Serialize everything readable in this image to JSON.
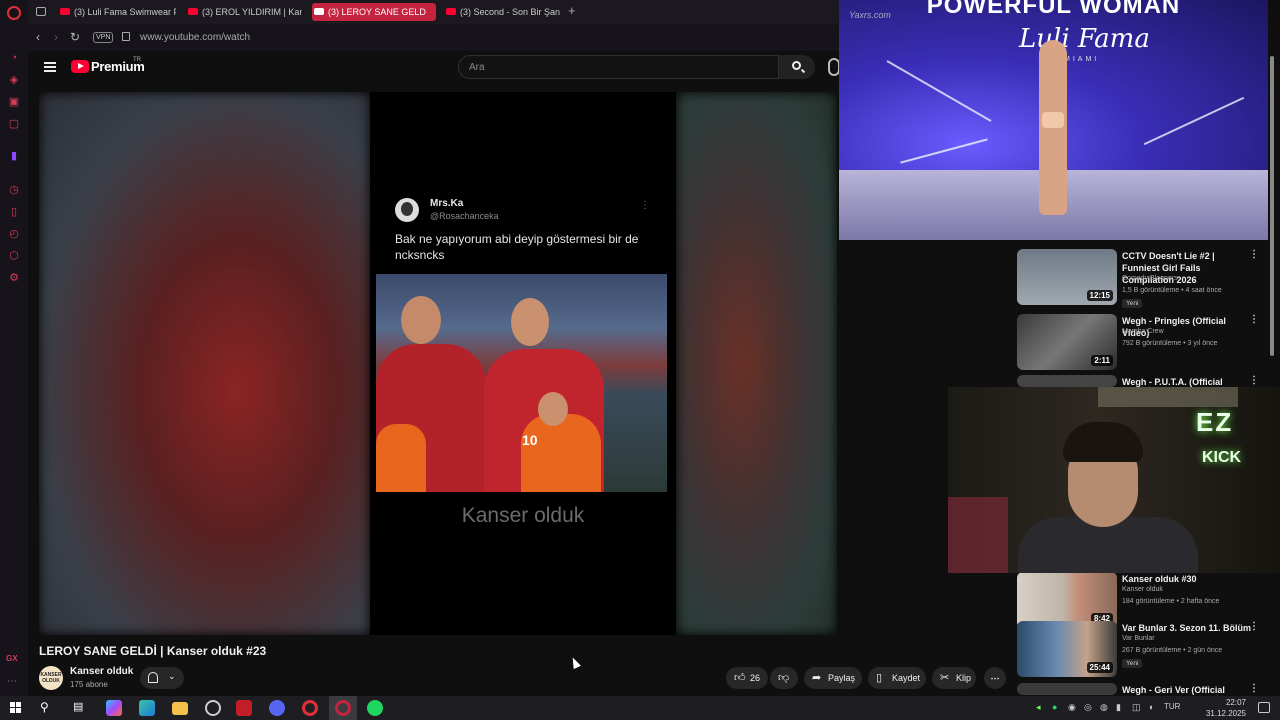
{
  "browser": {
    "tabs": [
      {
        "label": "(3) Luli Fama Swimwear Fa"
      },
      {
        "label": "(3) EROL YILDIRIM | Kans"
      },
      {
        "label": "(3) LEROY SANE GELD"
      },
      {
        "label": "(3) Second - Son Bir Şans"
      }
    ],
    "vpn_label": "VPN",
    "url": "www.youtube.com/watch",
    "sidebar_gx": "GX"
  },
  "youtube": {
    "brand": "Premium",
    "region": "TR",
    "search_placeholder": "Ara"
  },
  "player": {
    "tweet": {
      "name": "Mrs.Ka",
      "handle": "@Rosachanceka",
      "text": "Bak ne yapıyorum abi deyip göstermesi bir de ncksncks"
    },
    "jersey_number": "10",
    "watermark": "Kanser olduk"
  },
  "video": {
    "title": "LEROY SANE GELDİ | Kanser olduk #23",
    "channel": "Kanser olduk",
    "avatar_text": "KANSER OLDUK",
    "subscribers": "175 abone",
    "likes": "26",
    "share_label": "Paylaş",
    "save_label": "Kaydet",
    "clip_label": "Klip"
  },
  "pip": {
    "headline": "POWERFUL WOMAN",
    "brand": "Luli Fama",
    "sub": "MIAMI",
    "watermark": "Yaxrs.com"
  },
  "webcam": {
    "neon_top": "EZ",
    "neon_bottom": "KICK"
  },
  "recommendations": [
    {
      "title": "CCTV Doesn't Lie #2 | Funniest Girl Fails Compilation 2026",
      "channel": "Comedy Bloopers",
      "meta": "1,5 B görüntüleme • 4 saat önce",
      "badge": "Yeni",
      "duration": "12:15"
    },
    {
      "title": "Wegh - Pringles (Official Video)",
      "channel": "Mamba Crew",
      "meta": "792 B görüntüleme • 3 yıl önce",
      "badge": "",
      "duration": "2:11"
    },
    {
      "title": "Wegh - P.U.T.A. (Official Video)",
      "channel": "",
      "meta": "",
      "badge": "",
      "duration": ""
    },
    {
      "title": "Kanser olduk #30",
      "channel": "Kanser olduk",
      "meta": "184 görüntüleme • 2 hafta önce",
      "badge": "",
      "duration": "8:42"
    },
    {
      "title": "Var Bunlar 3. Sezon 11. Bölüm",
      "channel": "Var Bunlar",
      "meta": "267 B görüntüleme • 2 gün önce",
      "badge": "Yeni",
      "duration": "25:44"
    },
    {
      "title": "Wegh - Geri Ver (Official Music",
      "channel": "",
      "meta": "",
      "badge": "",
      "duration": ""
    }
  ],
  "taskbar": {
    "lang": "TUR",
    "time": "22:07",
    "date": "31.12.2025"
  }
}
